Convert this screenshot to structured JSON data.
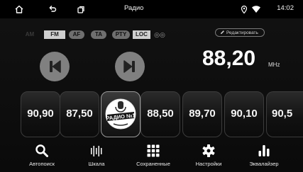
{
  "statusbar": {
    "title": "Радио",
    "time": "14:02",
    "icons": [
      "home-icon",
      "back-icon",
      "recent-apps-icon",
      "location-pin-icon",
      "wifi-icon"
    ]
  },
  "bands": {
    "am": "AM",
    "fm": "FM",
    "af": "AF",
    "ta": "TA",
    "pty": "PTY",
    "loc": "LOC",
    "stereo": "◎◎"
  },
  "edit_button": {
    "label": "Редактировать",
    "icon": "pencil-icon"
  },
  "tuner": {
    "frequency": "88,20",
    "unit": "MHz"
  },
  "presets": [
    {
      "label": "90,90"
    },
    {
      "label": "87,50"
    },
    {
      "label": "РАДИО №1",
      "logo": true
    },
    {
      "label": "88,50"
    },
    {
      "label": "89,70"
    },
    {
      "label": "90,10"
    },
    {
      "label": "90,5"
    }
  ],
  "toolbar": {
    "autosearch": "Автопоиск",
    "scale": "Шкала",
    "saved": "Сохраненные",
    "settings": "Настройки",
    "equalizer": "Эквалайзер"
  },
  "colors": {
    "background": "#0e0e0e",
    "button_gray": "#808080",
    "pill_gray": "#6f6f6f"
  }
}
